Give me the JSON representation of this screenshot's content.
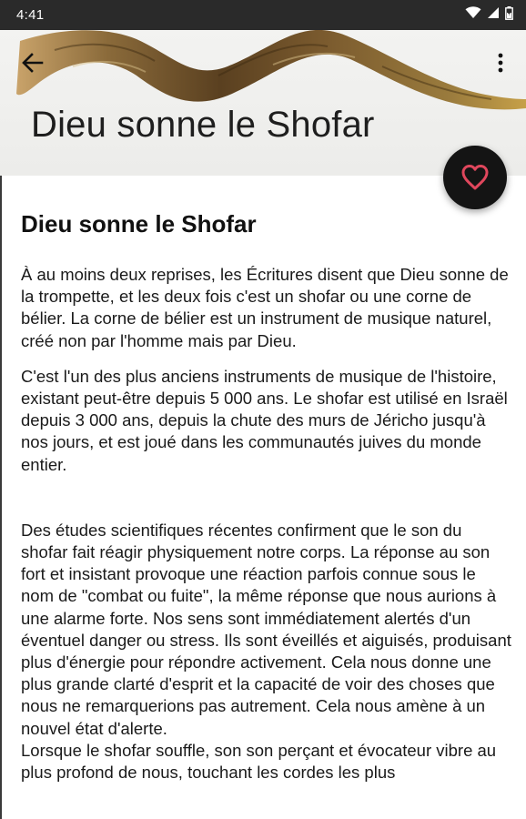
{
  "status_bar": {
    "time": "4:41",
    "icons": [
      "wifi-icon",
      "signal-icon",
      "battery-icon"
    ]
  },
  "toolbar": {
    "back_icon": "arrow-left-icon",
    "more_icon": "more-vertical-icon",
    "title": "Dieu sonne le Shofar"
  },
  "fab": {
    "icon": "heart-outline-icon",
    "color": "#e0475d"
  },
  "article": {
    "title": "Dieu sonne le Shofar",
    "paragraphs": [
      "À au moins deux reprises, les Écritures disent que Dieu sonne de la trompette, et les deux fois c'est un shofar ou une corne de bélier. La corne de bélier est un instrument de musique naturel, créé non par l'homme mais par Dieu.",
      "C'est l'un des plus anciens instruments de musique de l'histoire, existant peut-être depuis 5 000 ans. Le shofar est utilisé en Israël depuis 3 000 ans, depuis la chute des murs de Jéricho jusqu'à nos jours, et est joué dans les communautés juives du monde entier.",
      "Des études scientifiques récentes confirment que le son du shofar fait réagir physiquement notre corps. La réponse au son fort et insistant provoque une réaction parfois connue sous le nom de \"combat ou fuite\", la même réponse que nous aurions à une alarme forte. Nos sens sont immédiatement alertés d'un éventuel danger ou stress. Ils sont éveillés et aiguisés, produisant plus d'énergie pour répondre activement. Cela nous donne une plus grande clarté d'esprit et la capacité de voir des choses que nous ne remarquerions pas autrement. Cela nous amène à un nouvel état d'alerte.",
      "Lorsque le shofar souffle, son son perçant et évocateur vibre au plus profond de nous, touchant les cordes les plus"
    ]
  },
  "colors": {
    "status_bar": "#2a2a2a",
    "hero_background": "#f0f0ee",
    "fab_background": "#141414"
  }
}
